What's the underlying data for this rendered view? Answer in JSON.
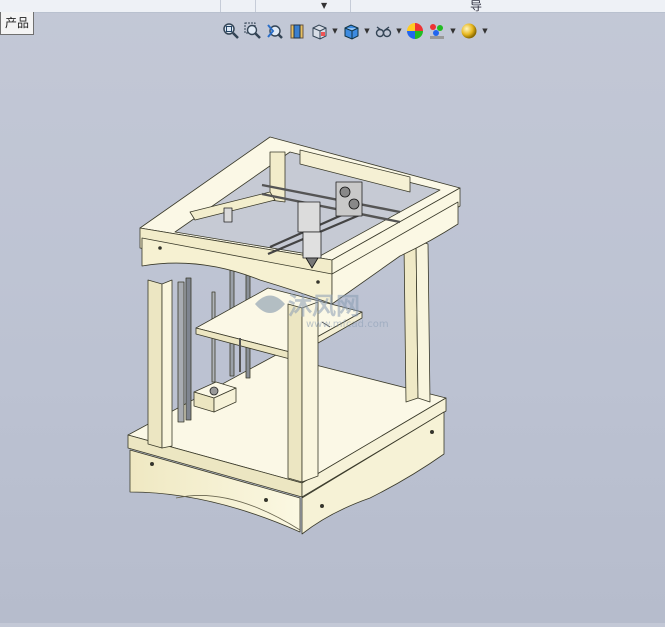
{
  "app": {
    "tab_label": "产品",
    "top_glyph": "导",
    "dropdown_glyph": "▼"
  },
  "heads_up_toolbar": {
    "items": [
      {
        "icon": "zoom-to-fit-icon",
        "has_dropdown": false
      },
      {
        "icon": "zoom-to-area-icon",
        "has_dropdown": false
      },
      {
        "icon": "previous-view-icon",
        "has_dropdown": false
      },
      {
        "icon": "section-view-icon",
        "has_dropdown": false
      },
      {
        "icon": "view-orientation-icon",
        "has_dropdown": true
      },
      {
        "icon": "display-style-icon",
        "has_dropdown": true
      },
      {
        "icon": "hide-show-items-icon",
        "has_dropdown": true
      },
      {
        "icon": "edit-appearance-icon",
        "has_dropdown": false
      },
      {
        "icon": "apply-scene-icon",
        "has_dropdown": true
      },
      {
        "icon": "view-settings-icon",
        "has_dropdown": true
      }
    ]
  },
  "watermark": {
    "title": "沐风网",
    "url": "www.mfcad.com"
  },
  "colors": {
    "background": "#bfc5d4",
    "model_face": "#f6f2d2",
    "model_shade": "#e6e0b8",
    "model_edge": "#3a3a2a",
    "rail": "#9aa0a8"
  }
}
